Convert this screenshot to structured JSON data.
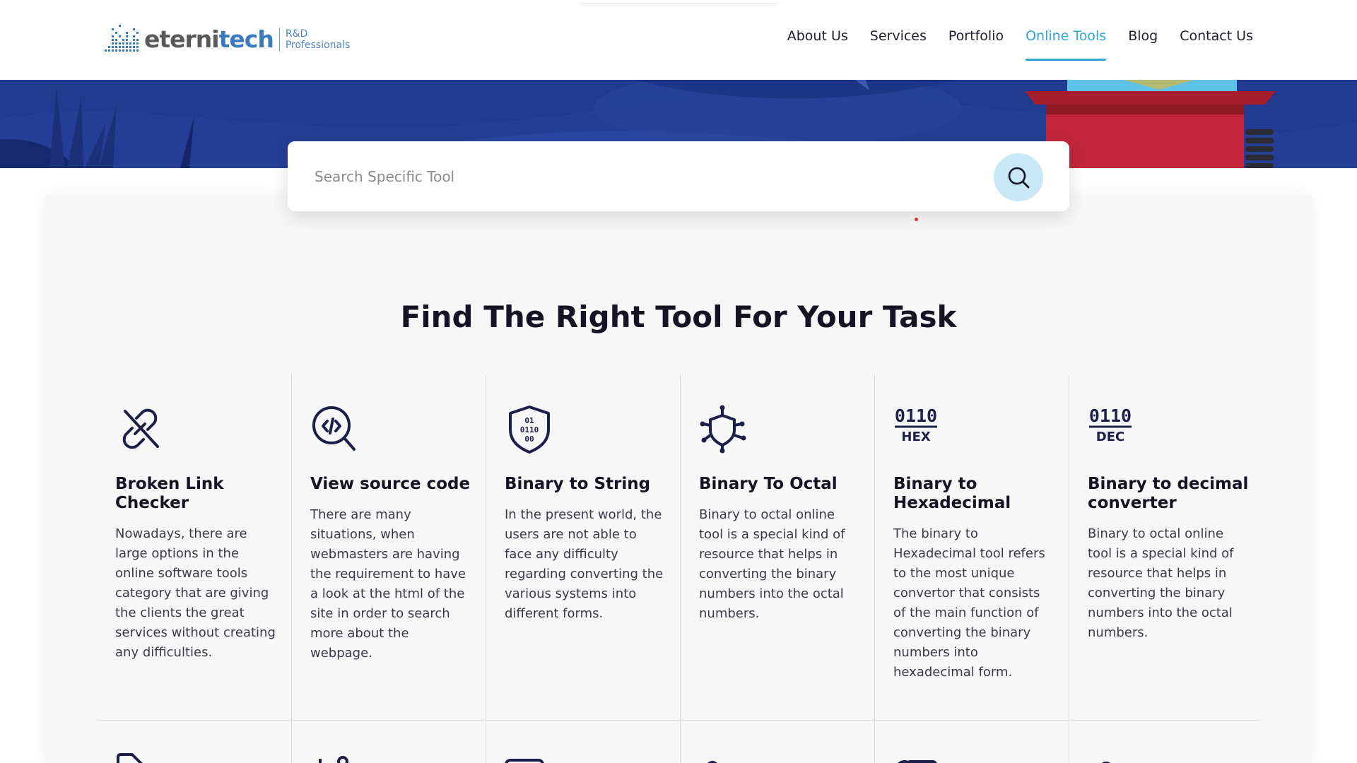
{
  "header": {
    "logo": {
      "brand_part1": "eterni",
      "brand_part2": "tech",
      "tagline_line1": "R&D",
      "tagline_line2": "Professionals"
    },
    "nav": [
      {
        "label": "About Us",
        "active": false
      },
      {
        "label": "Services",
        "active": false
      },
      {
        "label": "Portfolio",
        "active": false
      },
      {
        "label": "Online Tools",
        "active": true
      },
      {
        "label": "Blog",
        "active": false
      },
      {
        "label": "Contact Us",
        "active": false
      }
    ]
  },
  "search": {
    "placeholder": "Search Specific Tool",
    "value": "",
    "icon": "search-icon"
  },
  "section": {
    "title": "Find The Right Tool For Your Task"
  },
  "tools": [
    {
      "icon": "broken-link-icon",
      "title": "Broken Link Checker",
      "description": "Nowadays, there are large options in the online software tools category that are giving the clients the great services without creating any difficulties."
    },
    {
      "icon": "code-search-icon",
      "title": "View source code",
      "description": "There are many situations, when webmasters are having the requirement to have a look at the html of the site in order to search more about the webpage."
    },
    {
      "icon": "binary-shield-icon",
      "title": "Binary to String",
      "description": "In the present world, the users are not able to face any difficulty regarding converting the various systems into different forms."
    },
    {
      "icon": "shield-network-icon",
      "title": "Binary To Octal",
      "description": "Binary to octal online tool is a special kind of resource that helps in converting the binary numbers into the octal numbers."
    },
    {
      "icon": "binary-hex-icon",
      "icon_text_top": "0110",
      "icon_text_bottom": "HEX",
      "title": "Binary to Hexadecimal",
      "description": "The binary to Hexadecimal tool refers to the most unique convertor that consists of the main function of converting the binary numbers into hexadecimal form."
    },
    {
      "icon": "binary-dec-icon",
      "icon_text_top": "0110",
      "icon_text_bottom": "DEC",
      "title": "Binary to decimal converter",
      "description": "Binary to octal online tool is a special kind of resource that helps in converting the binary numbers into the octal numbers."
    }
  ],
  "next_row_icons": [
    "tag-icon",
    "slider-icon",
    "keyboard-icon",
    "lock-icon",
    "url-icon",
    "location-icon"
  ],
  "colors": {
    "accent": "#2ea3d6",
    "text": "#141424",
    "hero": "#1f3a8f",
    "search_button": "#c9e8f6",
    "logo_grey": "#58595b",
    "logo_blue": "#3a7bbf"
  }
}
